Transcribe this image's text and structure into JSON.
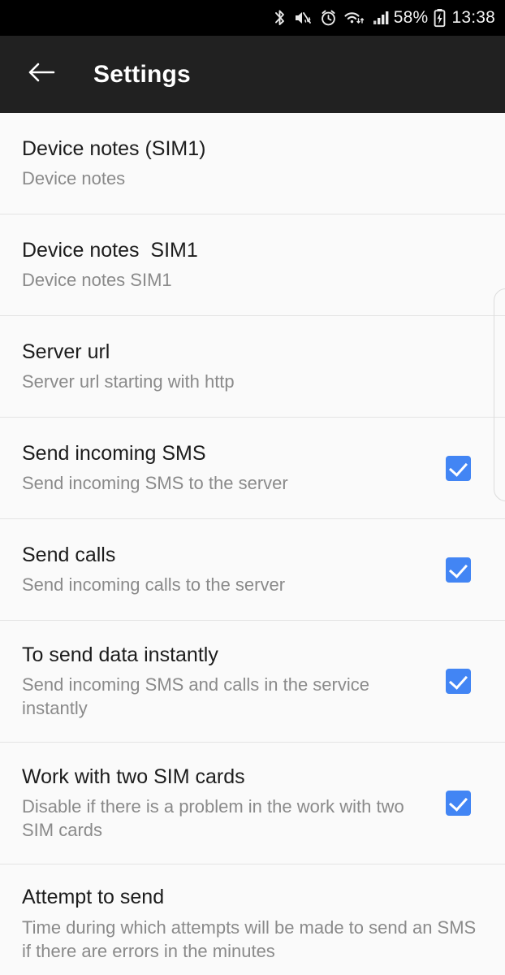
{
  "status_bar": {
    "icons": [
      "bluetooth-icon",
      "volume-mute-vibrate-icon",
      "alarm-clock-icon",
      "wifi-icon",
      "cellular-signal-icon"
    ],
    "battery_percent": "58%",
    "battery_icon": "battery-charging-icon",
    "time": "13:38"
  },
  "app_bar": {
    "back_icon": "back-arrow-icon",
    "title": "Settings"
  },
  "colors": {
    "accent": "#4285F4",
    "appbar_bg": "#212121",
    "page_bg": "#fafafa",
    "title_text": "#1c1c1c",
    "sub_text": "#8a8a8a",
    "divider": "#e4e4e4"
  },
  "settings": {
    "items": [
      {
        "title": "Device notes (SIM1)",
        "subtitle": "Device notes",
        "type": "text",
        "checked": null
      },
      {
        "title": "Device notes  SIM1",
        "subtitle": "Device notes SIM1",
        "type": "text",
        "checked": null
      },
      {
        "title": "Server url",
        "subtitle": "Server url starting with http",
        "type": "text",
        "checked": null
      },
      {
        "title": "Send incoming SMS",
        "subtitle": "Send incoming SMS to the server",
        "type": "checkbox",
        "checked": true
      },
      {
        "title": "Send calls",
        "subtitle": "Send incoming calls to the server",
        "type": "checkbox",
        "checked": true
      },
      {
        "title": "To send data instantly",
        "subtitle": "Send incoming SMS and calls in the service instantly",
        "type": "checkbox",
        "checked": true
      },
      {
        "title": "Work with two SIM cards",
        "subtitle": "Disable if there is a problem in the work with two SIM cards",
        "type": "checkbox",
        "checked": true
      },
      {
        "title": "Attempt to send",
        "subtitle": "Time during which attempts will be made to send an SMS if there are errors in the minutes",
        "type": "text",
        "checked": null
      }
    ]
  }
}
